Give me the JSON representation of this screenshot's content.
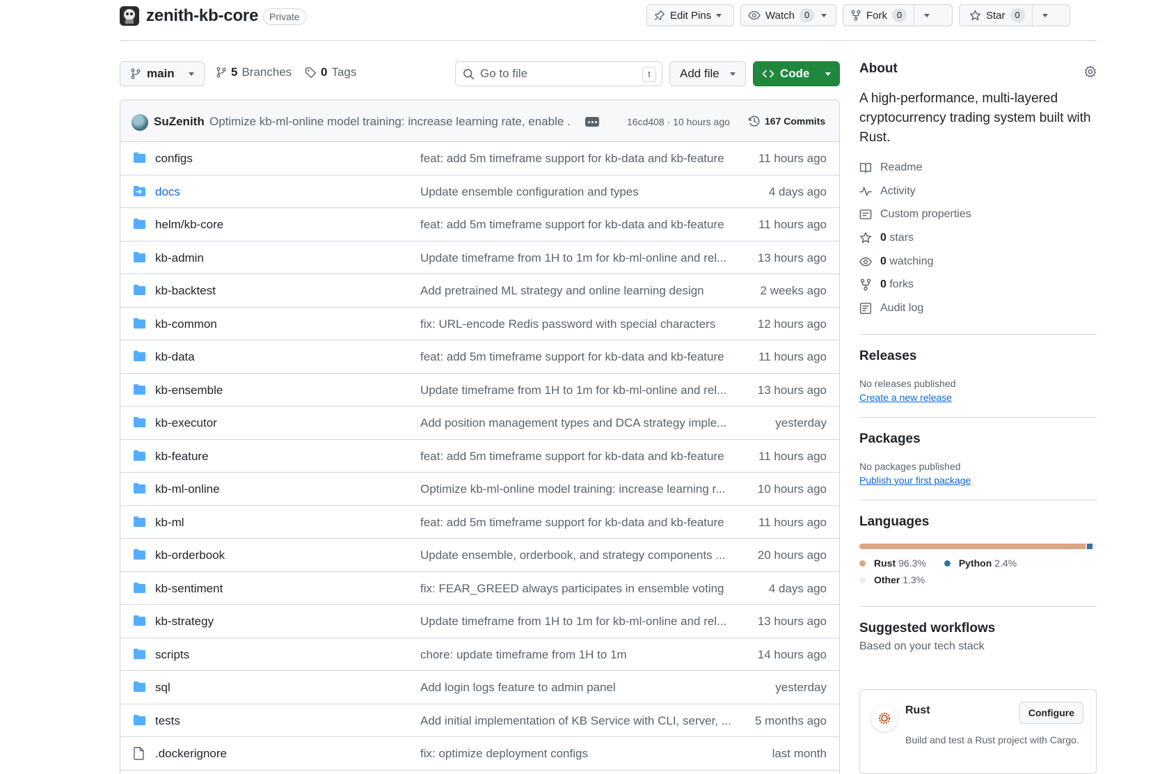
{
  "repo": {
    "name": "zenith-kb-core",
    "visibility": "Private",
    "edit_pins_label": "Edit Pins",
    "watch_label": "Watch",
    "watch_count": "0",
    "fork_label": "Fork",
    "fork_count": "0",
    "star_label": "Star",
    "star_count": "0"
  },
  "toolbar": {
    "branch": "main",
    "branches_count": "5",
    "branches_label": "Branches",
    "tags_count": "0",
    "tags_label": "Tags",
    "search_placeholder": "Go to file",
    "search_shortcut": "t",
    "add_file_label": "Add file",
    "code_label": "Code"
  },
  "latest_commit": {
    "author": "SuZenith",
    "message": "Optimize kb-ml-online model training: increase learning rate, enable ...",
    "sha": "16cd408",
    "time": "10 hours ago",
    "commits_count_label": "167 Commits"
  },
  "files": [
    {
      "type": "dir",
      "name": "configs",
      "message": "feat: add 5m timeframe support for kb-data and kb-feature",
      "age": "11 hours ago"
    },
    {
      "type": "submodule",
      "name": "docs",
      "message": "Update ensemble configuration and types",
      "age": "4 days ago"
    },
    {
      "type": "dir",
      "name": "helm/kb-core",
      "message": "feat: add 5m timeframe support for kb-data and kb-feature",
      "age": "11 hours ago"
    },
    {
      "type": "dir",
      "name": "kb-admin",
      "message": "Update timeframe from 1H to 1m for kb-ml-online and rel...",
      "age": "13 hours ago"
    },
    {
      "type": "dir",
      "name": "kb-backtest",
      "message": "Add pretrained ML strategy and online learning design",
      "age": "2 weeks ago"
    },
    {
      "type": "dir",
      "name": "kb-common",
      "message": "fix: URL-encode Redis password with special characters",
      "age": "12 hours ago"
    },
    {
      "type": "dir",
      "name": "kb-data",
      "message": "feat: add 5m timeframe support for kb-data and kb-feature",
      "age": "11 hours ago"
    },
    {
      "type": "dir",
      "name": "kb-ensemble",
      "message": "Update timeframe from 1H to 1m for kb-ml-online and rel...",
      "age": "13 hours ago"
    },
    {
      "type": "dir",
      "name": "kb-executor",
      "message": "Add position management types and DCA strategy imple...",
      "age": "yesterday"
    },
    {
      "type": "dir",
      "name": "kb-feature",
      "message": "feat: add 5m timeframe support for kb-data and kb-feature",
      "age": "11 hours ago"
    },
    {
      "type": "dir",
      "name": "kb-ml-online",
      "message": "Optimize kb-ml-online model training: increase learning r...",
      "age": "10 hours ago"
    },
    {
      "type": "dir",
      "name": "kb-ml",
      "message": "feat: add 5m timeframe support for kb-data and kb-feature",
      "age": "11 hours ago"
    },
    {
      "type": "dir",
      "name": "kb-orderbook",
      "message": "Update ensemble, orderbook, and strategy components ...",
      "age": "20 hours ago"
    },
    {
      "type": "dir",
      "name": "kb-sentiment",
      "message": "fix: FEAR_GREED always participates in ensemble voting",
      "age": "4 days ago"
    },
    {
      "type": "dir",
      "name": "kb-strategy",
      "message": "Update timeframe from 1H to 1m for kb-ml-online and rel...",
      "age": "13 hours ago"
    },
    {
      "type": "dir",
      "name": "scripts",
      "message": "chore: update timeframe from 1H to 1m",
      "age": "14 hours ago"
    },
    {
      "type": "dir",
      "name": "sql",
      "message": "Add login logs feature to admin panel",
      "age": "yesterday"
    },
    {
      "type": "dir",
      "name": "tests",
      "message": "Add initial implementation of KB Service with CLI, server, ...",
      "age": "5 months ago"
    },
    {
      "type": "file",
      "name": ".dockerignore",
      "message": "fix: optimize deployment configs",
      "age": "last month"
    }
  ],
  "about": {
    "heading": "About",
    "description": "A high-performance, multi-layered cryptocurrency trading system built with Rust.",
    "items": [
      {
        "icon": "book-icon",
        "label": "Readme",
        "count": ""
      },
      {
        "icon": "pulse-icon",
        "label": "Activity",
        "count": ""
      },
      {
        "icon": "note-icon",
        "label": "Custom properties",
        "count": ""
      },
      {
        "icon": "star-icon",
        "label": "stars",
        "count": "0"
      },
      {
        "icon": "eye-icon",
        "label": "watching",
        "count": "0"
      },
      {
        "icon": "fork-icon",
        "label": "forks",
        "count": "0"
      },
      {
        "icon": "log-icon",
        "label": "Audit log",
        "count": ""
      }
    ]
  },
  "releases": {
    "heading": "Releases",
    "empty_text": "No releases published",
    "create_link": "Create a new release"
  },
  "packages": {
    "heading": "Packages",
    "empty_text": "No packages published",
    "publish_link": "Publish your first package"
  },
  "languages": {
    "heading": "Languages",
    "items": [
      {
        "name": "Rust",
        "percent": "96.3%",
        "value": 96.3,
        "color": "#dea584"
      },
      {
        "name": "Python",
        "percent": "2.4%",
        "value": 2.4,
        "color": "#3572A5"
      },
      {
        "name": "Other",
        "percent": "1.3%",
        "value": 1.3,
        "color": "#ededed"
      }
    ]
  },
  "workflows": {
    "heading": "Suggested workflows",
    "subheading": "Based on your tech stack",
    "card_title": "Rust",
    "card_desc": "Build and test a Rust project with Cargo.",
    "configure_label": "Configure"
  },
  "colors": {
    "accent_green": "#1f883d",
    "link_blue": "#0969da",
    "folder_blue": "#54aeff"
  }
}
